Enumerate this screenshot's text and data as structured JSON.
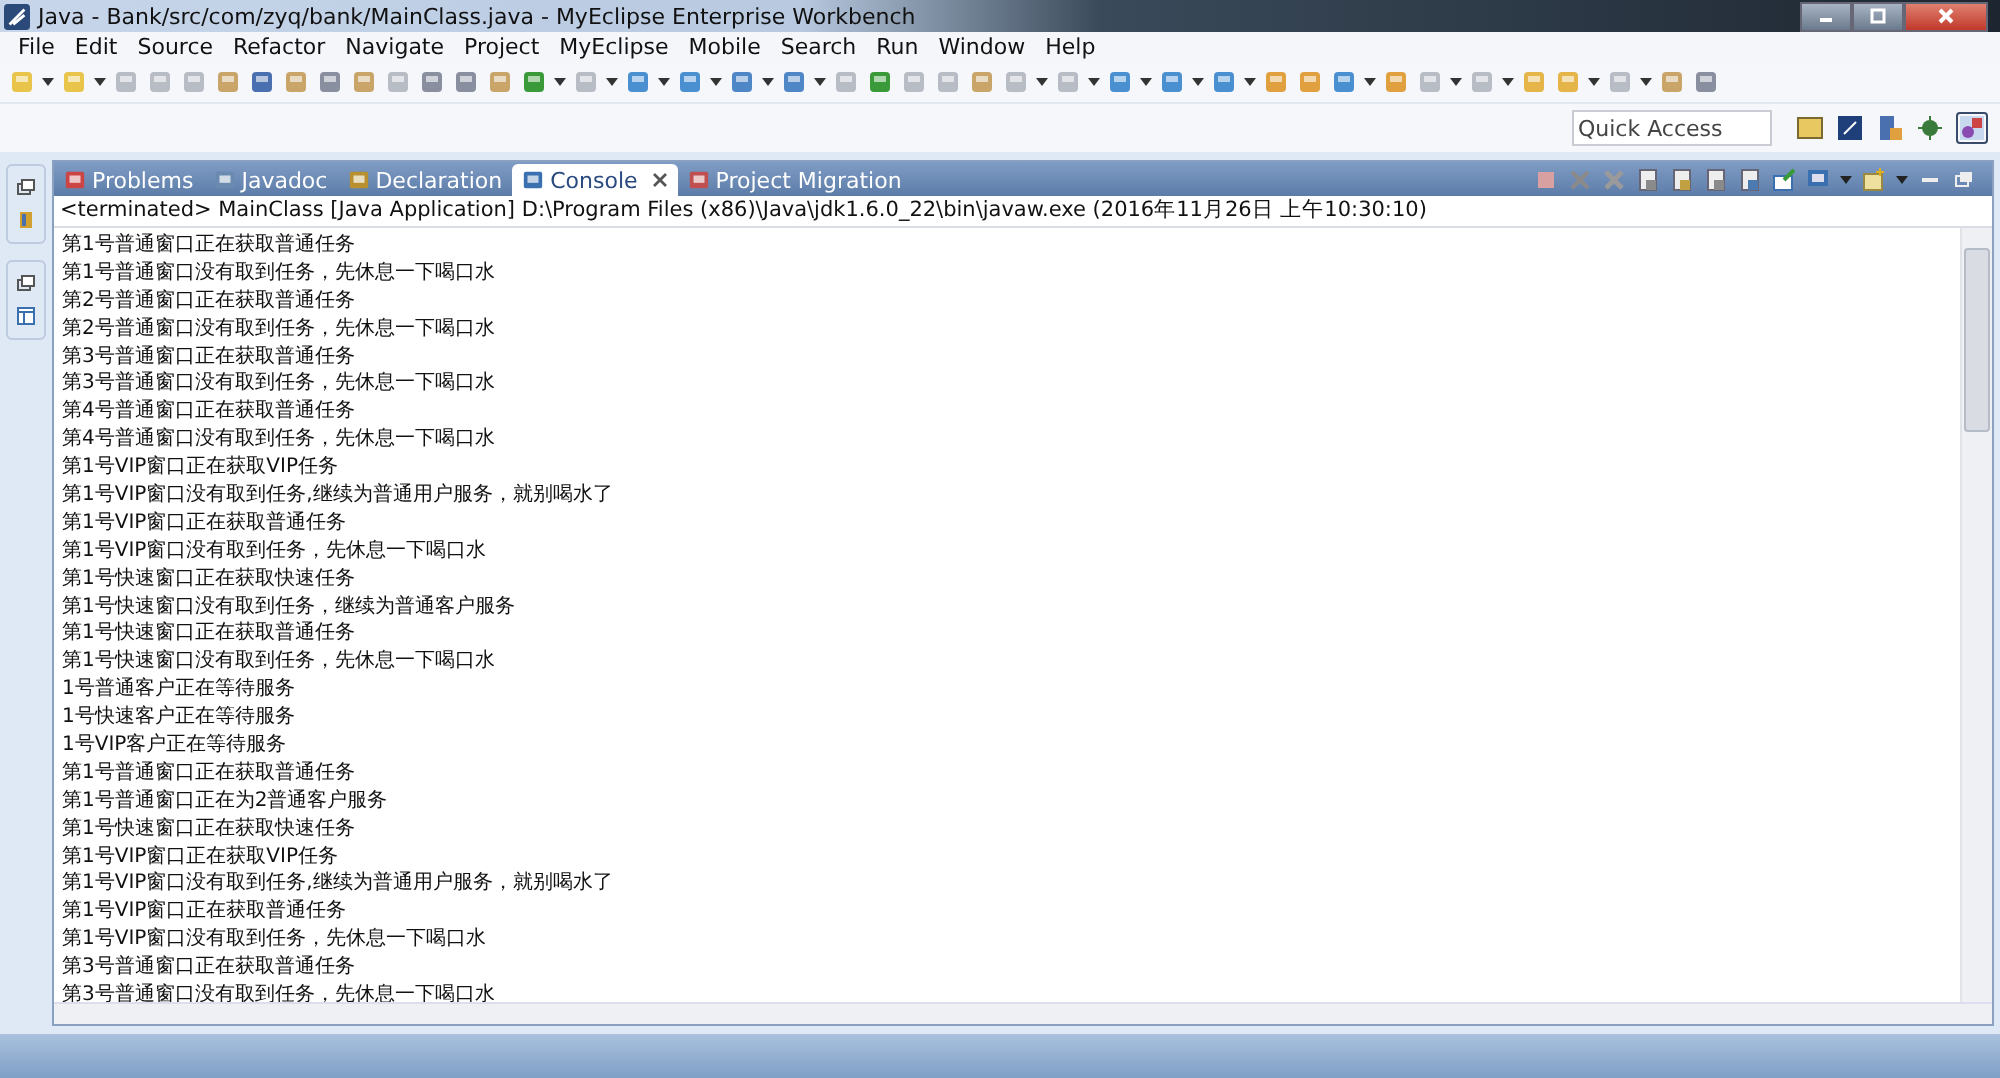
{
  "window": {
    "title": "Java - Bank/src/com/zyq/bank/MainClass.java - MyEclipse Enterprise Workbench"
  },
  "menu": [
    "File",
    "Edit",
    "Source",
    "Refactor",
    "Navigate",
    "Project",
    "MyEclipse",
    "Mobile",
    "Search",
    "Run",
    "Window",
    "Help"
  ],
  "quick_access": {
    "placeholder": "Quick Access"
  },
  "tabs": [
    {
      "label": "Problems",
      "selected": false
    },
    {
      "label": "Javadoc",
      "selected": false
    },
    {
      "label": "Declaration",
      "selected": false
    },
    {
      "label": "Console",
      "selected": true
    },
    {
      "label": "Project Migration",
      "selected": false
    }
  ],
  "console": {
    "header": "<terminated> MainClass [Java Application] D:\\Program Files (x86)\\Java\\jdk1.6.0_22\\bin\\javaw.exe (2016年11月26日 上午10:30:10)",
    "lines": [
      "第1号普通窗口正在获取普通任务",
      "第1号普通窗口没有取到任务，先休息一下喝口水",
      "第2号普通窗口正在获取普通任务",
      "第2号普通窗口没有取到任务，先休息一下喝口水",
      "第3号普通窗口正在获取普通任务",
      "第3号普通窗口没有取到任务，先休息一下喝口水",
      "第4号普通窗口正在获取普通任务",
      "第4号普通窗口没有取到任务，先休息一下喝口水",
      "第1号VIP窗口正在获取VIP任务",
      "第1号VIP窗口没有取到任务,继续为普通用户服务，就别喝水了",
      "第1号VIP窗口正在获取普通任务",
      "第1号VIP窗口没有取到任务，先休息一下喝口水",
      "第1号快速窗口正在获取快速任务",
      "第1号快速窗口没有取到任务，继续为普通客户服务",
      "第1号快速窗口正在获取普通任务",
      "第1号快速窗口没有取到任务，先休息一下喝口水",
      "1号普通客户正在等待服务",
      "1号快速客户正在等待服务",
      "1号VIP客户正在等待服务",
      "第1号普通窗口正在获取普通任务",
      "第1号普通窗口正在为2普通客户服务",
      "第1号快速窗口正在获取快速任务",
      "第1号VIP窗口正在获取VIP任务",
      "第1号VIP窗口没有取到任务,继续为普通用户服务，就别喝水了",
      "第1号VIP窗口正在获取普通任务",
      "第1号VIP窗口没有取到任务，先休息一下喝口水",
      "第3号普通窗口正在获取普通任务",
      "第3号普通窗口没有取到任务，先休息一下喝口水"
    ]
  }
}
